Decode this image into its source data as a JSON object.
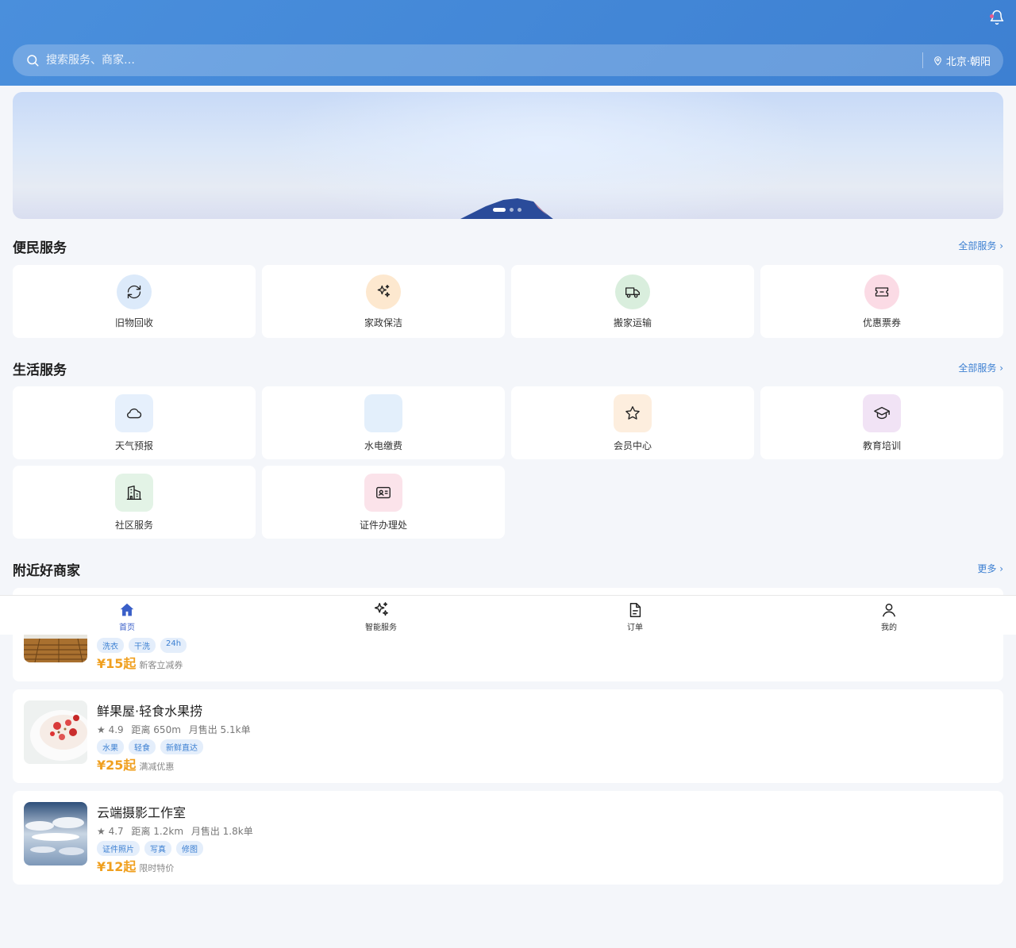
{
  "header": {
    "search_placeholder": "搜索服务、商家…",
    "location": "北京·朝阳"
  },
  "banner": {
    "slide_count": 3,
    "active_index": 0
  },
  "section1": {
    "title": "便民服务",
    "more": "全部服务 ›",
    "items": [
      {
        "label": "旧物回收",
        "icon": "refresh-icon",
        "color": "#dceafa"
      },
      {
        "label": "家政保洁",
        "icon": "sparkle-icon",
        "color": "#fde8cf"
      },
      {
        "label": "搬家运输",
        "icon": "truck-icon",
        "color": "#d9eedd"
      },
      {
        "label": "优惠票券",
        "icon": "ticket-icon",
        "color": "#fbdbe5"
      }
    ]
  },
  "section2": {
    "title": "生活服务",
    "more": "全部服务 ›",
    "items": [
      {
        "label": "天气预报",
        "icon": "cloud-icon",
        "color": "#e6f0fc"
      },
      {
        "label": "水电缴费",
        "icon": "blank-icon",
        "color": "#e3effb"
      },
      {
        "label": "会员中心",
        "icon": "star-icon",
        "color": "#fdeede"
      },
      {
        "label": "教育培训",
        "icon": "graduation-cap-icon",
        "color": "#f1e3f5"
      },
      {
        "label": "社区服务",
        "icon": "building-icon",
        "color": "#e3f3e6"
      },
      {
        "label": "证件办理处",
        "icon": "id-card-icon",
        "color": "#fbe3ea"
      }
    ]
  },
  "section3": {
    "title": "附近好商家",
    "more": "更多 ›",
    "shops": [
      {
        "name": "",
        "rating": "",
        "distance": "",
        "sold": "",
        "tags": [
          "洗衣",
          "干洗",
          "24h"
        ],
        "price": "¥15起",
        "price_note": "新客立减券"
      },
      {
        "name": "鲜果屋·轻食水果捞",
        "rating": "★ 4.9",
        "distance": "距离 650m",
        "sold": "月售出 5.1k单",
        "tags": [
          "水果",
          "轻食",
          "新鲜直达"
        ],
        "price": "¥25起",
        "price_note": "满减优惠"
      },
      {
        "name": "云端摄影工作室",
        "rating": "★ 4.7",
        "distance": "距离 1.2km",
        "sold": "月售出 1.8k单",
        "tags": [
          "证件照片",
          "写真",
          "修图"
        ],
        "price": "¥12起",
        "price_note": "限时特价"
      }
    ]
  },
  "tabbar": {
    "items": [
      {
        "label": "首页",
        "icon": "home-icon",
        "active": true
      },
      {
        "label": "智能服务",
        "icon": "sparkle-icon",
        "active": false
      },
      {
        "label": "订单",
        "icon": "document-icon",
        "active": false
      },
      {
        "label": "我的",
        "icon": "user-icon",
        "active": false
      }
    ]
  }
}
